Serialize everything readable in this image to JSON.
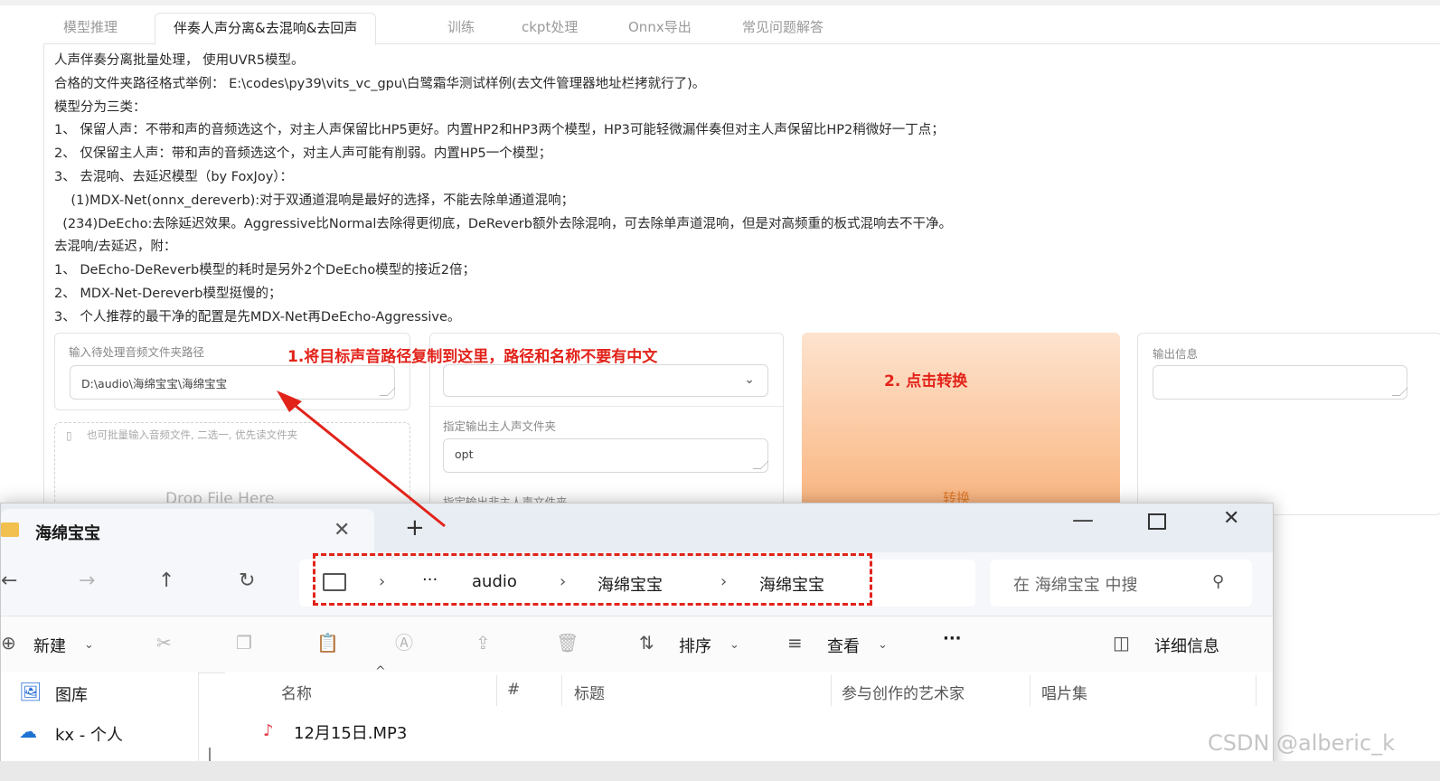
{
  "tabs": [
    "模型推理",
    "伴奏人声分离&去混响&去回声",
    "训练",
    "ckpt处理",
    "Onnx导出",
    "常见问题解答"
  ],
  "description": [
    "人声伴奏分离批量处理， 使用UVR5模型。",
    "合格的文件夹路径格式举例： E:\\codes\\py39\\vits_vc_gpu\\白鹭霜华测试样例(去文件管理器地址栏拷就行了)。",
    "模型分为三类：",
    "1、 保留人声：不带和声的音频选这个，对主人声保留比HP5更好。内置HP2和HP3两个模型，HP3可能轻微漏伴奏但对主人声保留比HP2稍微好一丁点；",
    "2、 仅保留主人声：带和声的音频选这个，对主人声可能有削弱。内置HP5一个模型；",
    "3、 去混响、去延迟模型（by FoxJoy）：",
    "    (1)MDX-Net(onnx_dereverb):对于双通道混响是最好的选择，不能去除单通道混响；",
    "  (234)DeEcho:去除延迟效果。Aggressive比Normal去除得更彻底，DeReverb额外去除混响，可去除单声道混响，但是对高频重的板式混响去不干净。",
    "去混响/去延迟，附：",
    "1、 DeEcho-DeReverb模型的耗时是另外2个DeEcho模型的接近2倍；",
    "2、 MDX-Net-Dereverb模型挺慢的；",
    "3、 个人推荐的最干净的配置是先MDX-Net再DeEcho-Aggressive。"
  ],
  "input_folder": {
    "label": "输入待处理音频文件夹路径",
    "value": "D:\\audio\\海绵宝宝\\海绵宝宝"
  },
  "file_drop": {
    "hint": "也可批量输入音频文件, 二选一, 优先读文件夹",
    "text": "Drop File Here"
  },
  "output_vocal": {
    "label": "指定输出主人声文件夹",
    "value": "opt"
  },
  "output_other": {
    "label": "指定输出非主人声文件夹"
  },
  "convert_button": "转换",
  "output_info": {
    "label": "输出信息"
  },
  "annotations": {
    "step1": "1.将目标声音路径复制到这里，路径和名称不要有中文",
    "step2": "2. 点击转换"
  },
  "explorer": {
    "tab_title": "海绵宝宝",
    "breadcrumb": [
      "audio",
      "海绵宝宝",
      "海绵宝宝"
    ],
    "search_placeholder": "在 海绵宝宝 中搜",
    "toolbar": {
      "new": "新建",
      "sort": "排序",
      "view": "查看",
      "details": "详细信息"
    },
    "nav": [
      "图库",
      "kx - 个人"
    ],
    "columns": [
      "名称",
      "#",
      "标题",
      "参与创作的艺术家",
      "唱片集"
    ],
    "files": [
      {
        "name": "12月15日.MP3"
      }
    ]
  },
  "watermark": "CSDN @alberic_k",
  "colors": {
    "annotation": "#e2231a",
    "convert_button": "#fbc79e"
  }
}
